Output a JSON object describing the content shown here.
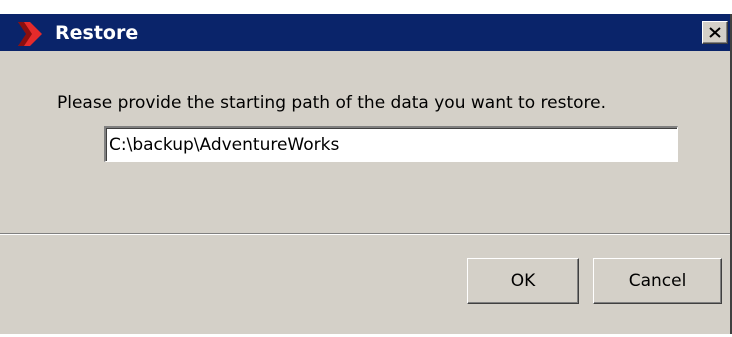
{
  "window": {
    "title": "Restore",
    "close_label": "✕"
  },
  "prompt": {
    "text": "Please provide the starting path of the data you want to restore."
  },
  "path_input": {
    "value": "C:\\backup\\AdventureWorks"
  },
  "buttons": {
    "ok_label": "OK",
    "cancel_label": "Cancel"
  },
  "colors": {
    "titlebar": "#0a246a",
    "dialog_bg": "#d4d0c8",
    "icon_red": "#e52b2b"
  },
  "icons": {
    "app": "app-logo-icon",
    "close": "close-icon"
  }
}
